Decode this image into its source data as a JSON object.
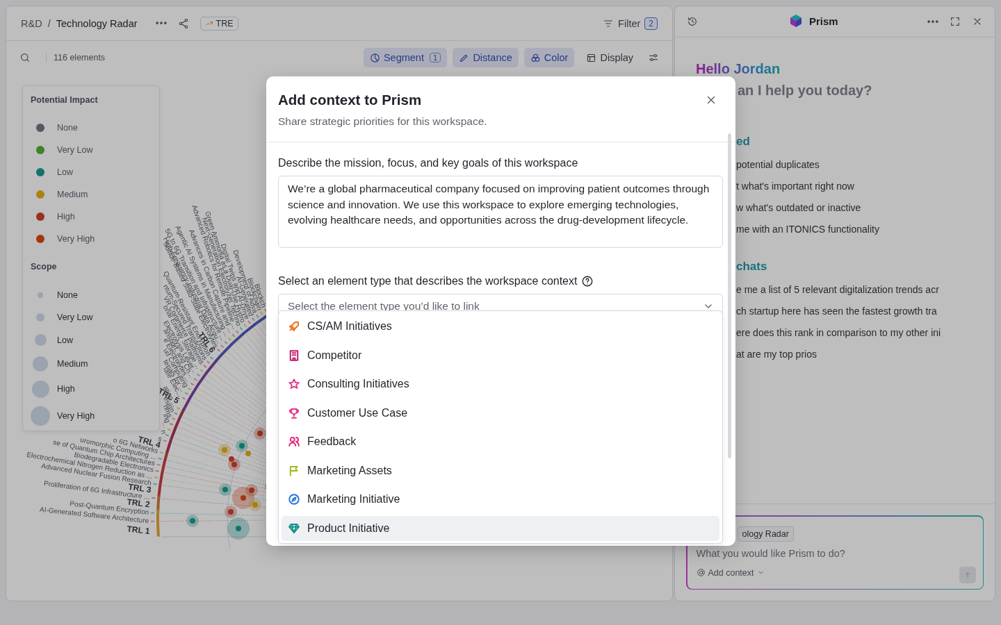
{
  "workspace": {
    "breadcrumb": {
      "parent": "R&D",
      "separator": "/",
      "current": "Technology Radar"
    },
    "tag": "TRE",
    "filter": {
      "label": "Filter",
      "count": "2"
    },
    "count": "116 elements",
    "buttons": [
      {
        "label": "Segment",
        "badge": "1",
        "active": true
      },
      {
        "label": "Distance",
        "active": true
      },
      {
        "label": "Color",
        "active": true
      },
      {
        "label": "Display",
        "active": false
      }
    ]
  },
  "legend": {
    "sections": [
      {
        "title": "Potential Impact",
        "kind": "color",
        "items": [
          {
            "label": "None",
            "color": "#535862"
          },
          {
            "label": "Very Low",
            "color": "#3e8324"
          },
          {
            "label": "Low",
            "color": "#12746a"
          },
          {
            "label": "Medium",
            "color": "#a98213"
          },
          {
            "label": "High",
            "color": "#993020"
          },
          {
            "label": "Very High",
            "color": "#a73410"
          }
        ]
      },
      {
        "title": "Scope",
        "kind": "size",
        "items": [
          {
            "label": "None"
          },
          {
            "label": "Very Low"
          },
          {
            "label": "Low"
          },
          {
            "label": "Medium"
          },
          {
            "label": "High"
          },
          {
            "label": "Very High"
          }
        ]
      }
    ]
  },
  "radar": {
    "labels": [
      {
        "text": "Blockch",
        "kind": "element"
      },
      {
        "text": "Blockchain",
        "kind": "element"
      },
      {
        "text": "Development of Adva",
        "kind": "element"
      },
      {
        "text": "AI-Generated",
        "kind": "element"
      },
      {
        "text": "Digital Twins and AI-Drive",
        "kind": "element"
      },
      {
        "text": "Green Ammonia as a Dual-Use Hydro",
        "kind": "element"
      },
      {
        "text": "Next-Generation Electrolyzer Techno",
        "kind": "element"
      },
      {
        "text": "Advanced Robotics for Remote Pipeline ...",
        "kind": "element"
      },
      {
        "text": "Advances in Carbon Capture and ...",
        "kind": "element"
      },
      {
        "text": "Agentic AI Systems in Manufacturing ...",
        "kind": "element"
      },
      {
        "text": "5G to 6G Transition and Infrastructure ...",
        "kind": "element"
      },
      {
        "text": "High-Frequency Industrial Data Acqu...",
        "kind": "element"
      },
      {
        "text": "Sulfide-Based Solid-State Electrolytes",
        "kind": "element"
      },
      {
        "text": "TRL 6",
        "kind": "segment",
        "color": "#42448a"
      },
      {
        "text": "Quantum-Resistant Encryption",
        "kind": "element"
      },
      {
        "text": "ntum-Secured Transactions",
        "kind": "element"
      },
      {
        "text": "VR Commerce Platforms",
        "kind": "element"
      },
      {
        "text": "onal Energy Storage ...",
        "kind": "element"
      },
      {
        "text": "Electrolysis Lever...",
        "kind": "element"
      },
      {
        "text": "ansport, and Ch...",
        "kind": "element"
      },
      {
        "text": "e Electrolytes ...",
        "kind": "element"
      },
      {
        "text": "ud Computing",
        "kind": "element"
      },
      {
        "text": "terials for ...",
        "kind": "element"
      },
      {
        "text": "tate Elec...",
        "kind": "element"
      },
      {
        "text": "TRL 5",
        "kind": "segment",
        "color": "#5d3277"
      },
      {
        "text": "ation ...",
        "kind": "element"
      },
      {
        "text": "esign",
        "kind": "element"
      },
      {
        "text": "hms",
        "kind": "element"
      },
      {
        "text": "ing",
        "kind": "element"
      },
      {
        "text": "...",
        "kind": "element"
      },
      {
        "text": "n",
        "kind": "element"
      },
      {
        "text": "s",
        "kind": "element"
      },
      {
        "text": "TRL 4",
        "kind": "segment",
        "color": "#7f2a3e"
      },
      {
        "text": "o 6G Networks",
        "kind": "element"
      },
      {
        "text": "uromorphic Computing ...",
        "kind": "element"
      },
      {
        "text": "se of Quantum Chip Architectures",
        "kind": "element"
      },
      {
        "text": "Biodegradable Electronics",
        "kind": "element"
      },
      {
        "text": "Electrochemical Nitrogen Reduction as ...",
        "kind": "element"
      },
      {
        "text": "Advanced Nuclear Fusion Research",
        "kind": "element"
      },
      {
        "text": "TRL 3",
        "kind": "segment",
        "color": "#962e30"
      },
      {
        "text": "Proliferation of 6G Infrastructure ...",
        "kind": "element"
      },
      {
        "text": "TRL 2",
        "kind": "segment",
        "color": "#965a2a"
      },
      {
        "text": "Post-Quantum Encryption",
        "kind": "element"
      },
      {
        "text": "AI-Generated Software Architecture",
        "kind": "element"
      },
      {
        "text": "TRL 1",
        "kind": "segment",
        "color": "#a87c24"
      }
    ]
  },
  "assistant": {
    "title": "Prism",
    "greeting": "Hello Jordan",
    "question": "an I help you today?",
    "sections": [
      {
        "title": "ed",
        "items": [
          "potential duplicates",
          "t what's important right now",
          "w what's outdated or inactive",
          "me with an ITONICS functionality"
        ]
      },
      {
        "title": "chats",
        "items": [
          "e me a list of 5 relevant digitalization trends acr",
          "ch startup here has seen the fastest growth tra",
          "ere does this rank in comparison to my other ini",
          "at are my top prios"
        ]
      }
    ],
    "composer": {
      "chip": "ology Radar",
      "placeholder": "What you would like Prism to do?",
      "add_context": "Add context"
    }
  },
  "modal": {
    "title": "Add context to Prism",
    "subtitle": "Share strategic priorities for this workspace.",
    "description": {
      "label": "Describe the mission, focus, and key goals of this workspace",
      "value": "We’re a global pharmaceutical company focused on improving patient outcomes through science and innovation. We use this workspace to explore emerging technologies, evolving healthcare needs, and opportunities across the drug-development lifecycle."
    },
    "select": {
      "label": "Select an element type that describes the workspace context",
      "placeholder": "Select the element type you’d like to link"
    },
    "options": [
      {
        "label": "CS/AM Initiatives",
        "color": "#f0701e",
        "selected": false
      },
      {
        "label": "Competitor",
        "color": "#c2186b",
        "selected": false
      },
      {
        "label": "Consulting Initiatives",
        "color": "#e6368f",
        "selected": false
      },
      {
        "label": "Customer Use Case",
        "color": "#e6368f",
        "selected": false
      },
      {
        "label": "Feedback",
        "color": "#e2287a",
        "selected": false
      },
      {
        "label": "Marketing Assets",
        "color": "#a3b81a",
        "selected": false
      },
      {
        "label": "Marketing Initiative",
        "color": "#2a73d9",
        "selected": false
      },
      {
        "label": "Product Initiative",
        "color": "#0f8f86",
        "selected": true
      }
    ]
  }
}
